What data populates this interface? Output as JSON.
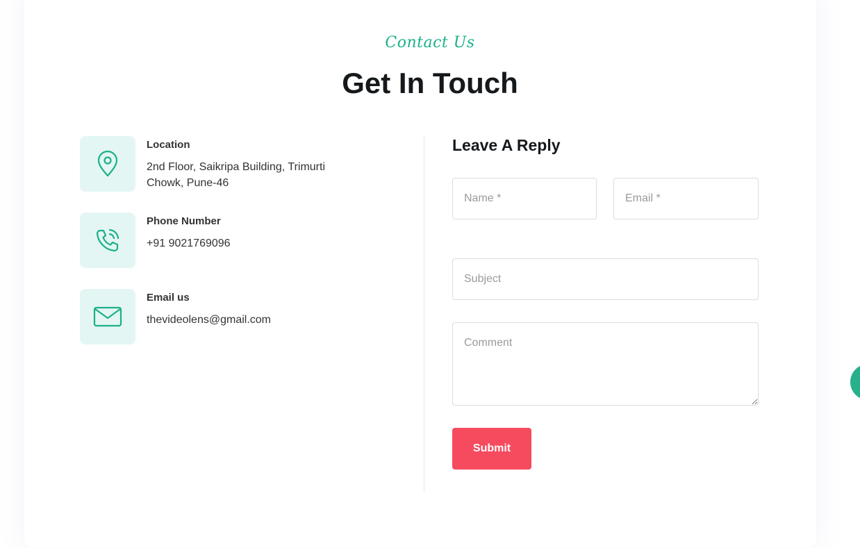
{
  "header": {
    "eyebrow": "Contact Us",
    "title": "Get In Touch"
  },
  "contact_info": [
    {
      "icon": "location-pin-icon",
      "label": "Location",
      "text": "2nd Floor, Saikripa Building, Trimurti Chowk, Pune-46"
    },
    {
      "icon": "phone-icon",
      "label": "Phone Number",
      "text": "+91 9021769096"
    },
    {
      "icon": "mail-icon",
      "label": "Email us",
      "text": "thevideolens@gmail.com"
    }
  ],
  "form": {
    "title": "Leave A Reply",
    "name_placeholder": "Name *",
    "email_placeholder": "Email *",
    "subject_placeholder": "Subject",
    "comment_placeholder": "Comment",
    "submit_label": "Submit"
  },
  "colors": {
    "accent": "#1bb08a",
    "icon_bg": "#e3f6f3",
    "submit": "#f64a5f"
  }
}
